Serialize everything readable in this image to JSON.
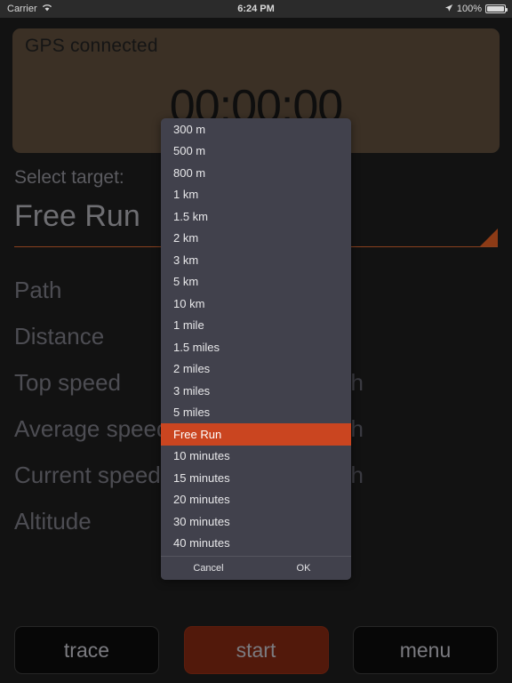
{
  "statusbar": {
    "carrier": "Carrier",
    "wifi_icon": "wifi-icon",
    "time": "6:24 PM",
    "location_icon": "location-arrow-icon",
    "battery_percent": "100%",
    "battery_icon": "battery-full-icon"
  },
  "gps_panel": {
    "status": "GPS connected",
    "timer": "00:00:00",
    "background_color": "#3b3025"
  },
  "select": {
    "label": "Select target:",
    "value": "Free Run",
    "accent_color": "#8d3b16"
  },
  "stats": [
    {
      "label": "Path",
      "unit": ""
    },
    {
      "label": "Distance",
      "unit": ""
    },
    {
      "label": "Top speed",
      "unit": "km/h"
    },
    {
      "label": "Average speed",
      "unit": "km/h"
    },
    {
      "label": "Current speed",
      "unit": "km/h"
    },
    {
      "label": "Altitude",
      "unit": ""
    }
  ],
  "buttons": {
    "trace": "trace",
    "start": "start",
    "menu": "menu",
    "start_color": "#52190b"
  },
  "dropdown": {
    "selected": "Free Run",
    "highlight_color": "#ca4520",
    "background_color": "#41414c",
    "items": [
      "300 m",
      "500 m",
      "800 m",
      "1 km",
      "1.5 km",
      "2 km",
      "3 km",
      "5 km",
      "10 km",
      "1 mile",
      "1.5 miles",
      "2 miles",
      "3 miles",
      "5 miles",
      "Free Run",
      "10 minutes",
      "15 minutes",
      "20 minutes",
      "30 minutes",
      "40 minutes"
    ],
    "cancel_label": "Cancel",
    "ok_label": "OK"
  }
}
